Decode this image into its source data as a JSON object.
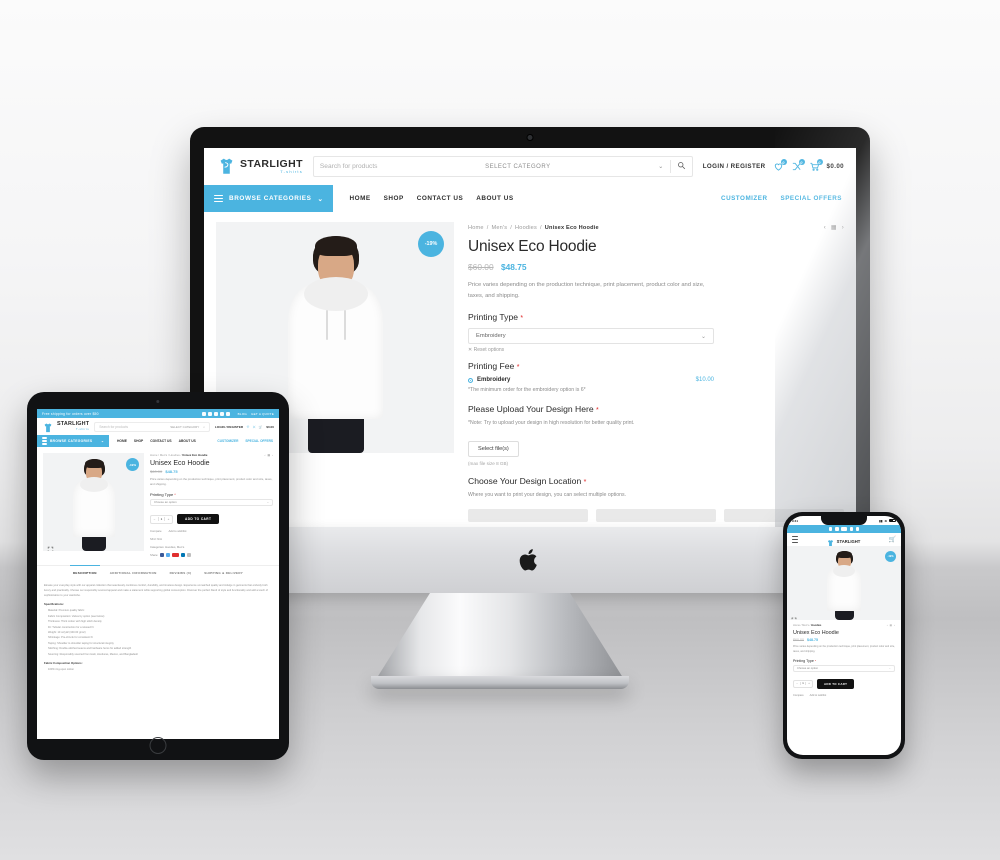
{
  "brand": {
    "name": "STARLIGHT",
    "tagline": "T-shirts",
    "accent": "#4bb4e0"
  },
  "desktop": {
    "header": {
      "search_placeholder": "Search for products",
      "category_selector": "SELECT CATEGORY",
      "search_icon": "search-icon",
      "account_link": "LOGIN / REGISTER",
      "wishlist_count": "0",
      "compare_count": "0",
      "cart_count": "0",
      "cart_total": "$0.00"
    },
    "nav": {
      "browse_label": "BROWSE CATEGORIES",
      "links": [
        "HOME",
        "SHOP",
        "CONTACT US",
        "ABOUT US"
      ],
      "right_links": [
        "CUSTOMIZER",
        "SPECIAL OFFERS"
      ]
    },
    "product": {
      "breadcrumb": [
        "Home",
        "Men's",
        "Hoodies"
      ],
      "breadcrumb_current": "Unisex Eco Hoodie",
      "sale_badge": "-19%",
      "title": "Unisex Eco Hoodie",
      "price_old": "$60.00",
      "price_new": "$48.75",
      "price_note": "Price varies depending on the production technique, print placement, product color and size, taxes, and shipping.",
      "printing_type_label": "Printing Type",
      "printing_type_value": "Embroidery",
      "reset_label": "Reset options",
      "printing_fee_label": "Printing Fee",
      "printing_fee_option": "Embroidery",
      "printing_fee_amount": "$10.00",
      "printing_fee_note": "*The minimum order for the embroidery option is 6*",
      "upload_label": "Please Upload Your Design Here",
      "upload_note": "*Note: Try to upload your design in high resolution for better quality print.",
      "upload_button": "Select file(s)",
      "upload_maxsize": "(max file size 8 GB)",
      "location_label": "Choose Your Design Location",
      "location_note": "Where you want to print your design, you can select multiple options.",
      "required_marker": "*"
    }
  },
  "tablet": {
    "topbar": {
      "announcement": "Free shipping for orders over $50",
      "links": [
        "BLOG",
        "GET A QUOTE"
      ]
    },
    "header": {
      "search_placeholder": "Search for products",
      "category_selector": "SELECT CATEGORY",
      "account_link": "LOGIN / REGISTER",
      "cart_total": "$0.00"
    },
    "nav": {
      "browse_label": "BROWSE CATEGORIES",
      "links": [
        "HOME",
        "SHOP",
        "CONTACT US",
        "ABOUT US"
      ],
      "right_links": [
        "CUSTOMIZER",
        "SPECIAL OFFERS"
      ]
    },
    "product": {
      "breadcrumb": [
        "Home",
        "Men's",
        "Hoodies"
      ],
      "breadcrumb_current": "Unisex Eco Hoodie",
      "sale_badge": "-19%",
      "title": "Unisex Eco Hoodie",
      "price_old": "$60.00",
      "price_new": "$48.75",
      "price_note": "Price varies depending on the production technique, print placement, product color and size, taxes, and shipping.",
      "printing_type_label": "Printing Type",
      "printing_type_value": "Choose an option",
      "quantity": "1",
      "add_to_cart": "ADD TO CART",
      "compare": "Compare",
      "wishlist": "Add to wishlist",
      "sku_line": "SKU: N/A",
      "categories_line": "Categories: Hoodies, Men's",
      "share_label": "Share:"
    },
    "tabs": [
      "DESCRIPTION",
      "ADDITIONAL INFORMATION",
      "REVIEWS (0)",
      "SHIPPING & DELIVERY"
    ],
    "description": {
      "intro": "Elevate your everyday style with our apparel collection that seamlessly combines comfort, durability, and timeless design. Experience unmatched quality and indulge in garments that embody both luxury and practicality. Choose our responsibly sourced apparel and make a statement while supporting global consumption. Discover the perfect blend of style and functionality and add a touch of sophistication to your wardrobe.",
      "spec_heading": "Specifications:",
      "specs": [
        "Material: Premium quality fabric",
        "Fabric Composition: Varies by option (see below)",
        "Thickness: Thick cotton with high stitch density",
        "Fit: Tubular construction for a relaxed fit",
        "Weight: 10 oz/yd2 (340.00 g/m2)",
        "Shrinkage: Pre-shrunk for consistent fit",
        "Taping: Shoulder to shoulder taping for structural integrity",
        "Stitching: Double-stitched seams and hardware hems for added strength",
        "Sourcing: Responsibly sourced from Haiti, Honduras, Mexico, and Bangladesh"
      ],
      "fabric_heading": "Fabric Composition Options:",
      "fabric_options": [
        "100% ring-spun cotton"
      ]
    }
  },
  "phone": {
    "status": {
      "time": "9:41",
      "carrier_signal": "signal-icon",
      "wifi": "wifi-icon",
      "battery": "battery-icon"
    },
    "product": {
      "breadcrumb": [
        "Home",
        "Men's",
        "Hoodies"
      ],
      "sale_badge": "-19%",
      "title": "Unisex Eco Hoodie",
      "price_old": "$60.00",
      "price_new": "$48.75",
      "price_note": "Price varies depending on the production technique, print placement, product color and size, taxes, and shipping.",
      "printing_type_label": "Printing Type",
      "printing_type_value": "Choose an option",
      "quantity": "1",
      "add_to_cart": "ADD TO CART",
      "compare": "Compare",
      "wishlist": "Add to wishlist"
    }
  },
  "icons": {
    "menu": "hamburger-icon",
    "chevron": "chevron-down-icon",
    "search": "search-icon",
    "heart": "heart-icon",
    "compare": "compare-icon",
    "cart": "cart-icon",
    "expand": "expand-icon",
    "prev": "chevron-left-icon",
    "grid": "grid-icon",
    "next": "chevron-right-icon",
    "apple": "apple-logo-icon"
  }
}
